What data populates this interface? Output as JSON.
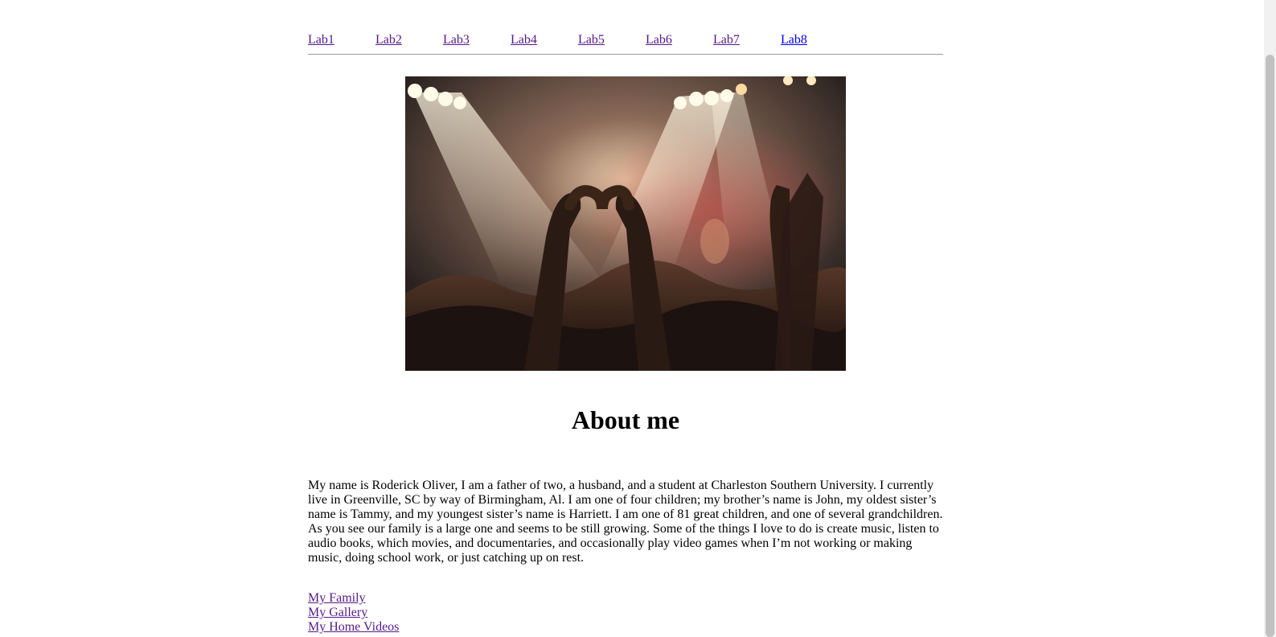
{
  "nav": {
    "items": [
      {
        "label": "Lab1",
        "visited": true
      },
      {
        "label": "Lab2",
        "visited": true
      },
      {
        "label": "Lab3",
        "visited": true
      },
      {
        "label": "Lab4",
        "visited": true
      },
      {
        "label": "Lab5",
        "visited": true
      },
      {
        "label": "Lab6",
        "visited": true
      },
      {
        "label": "Lab7",
        "visited": true
      },
      {
        "label": "Lab8",
        "visited": false
      }
    ]
  },
  "hero": {
    "image_alt": "Concert crowd with hands forming a heart under stage lights"
  },
  "about": {
    "heading": "About me",
    "paragraph": "My name is Roderick Oliver, I am a father of two, a husband, and a student at Charleston Southern University. I currently live in Greenville, SC by way of Birmingham, Al. I am one of four children; my brother’s name is John, my oldest sister’s name is Tammy, and my youngest sister’s name is Harriett. I am one of 81 great children, and one of several grandchildren. As you see our family is a large one and seems to be still growing. Some of the things I love to do is create music, listen to audio books, which movies, and documentaries, and occasionally play video games when I’m not working or making music, doing school work, or just catching up on rest."
  },
  "links": {
    "family": "My Family",
    "gallery": "My Gallery",
    "videos": "My Home Videos"
  },
  "colors": {
    "visited_link": "#551a8b",
    "unvisited_link": "#0000ee",
    "rule": "#9a9a9a"
  }
}
